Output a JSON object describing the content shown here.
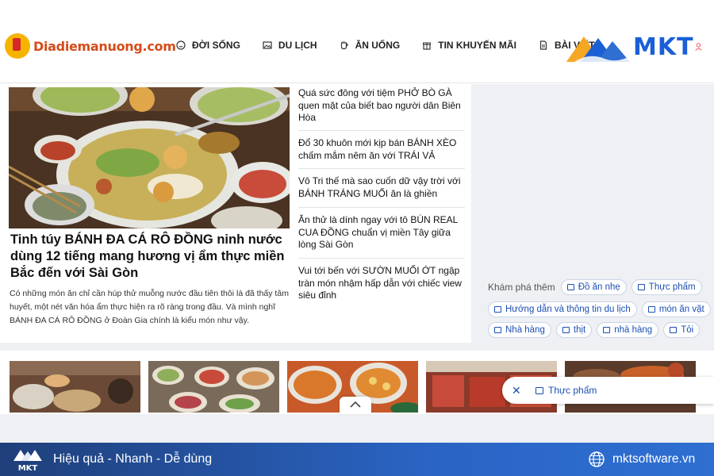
{
  "site": {
    "logo_text": "Diadiemanuong",
    "logo_suffix": ".com"
  },
  "nav": [
    {
      "label": "ĐỜI SỐNG",
      "icon": "smile-icon"
    },
    {
      "label": "DU LỊCH",
      "icon": "image-icon"
    },
    {
      "label": "ĂN UỐNG",
      "icon": "cup-icon"
    },
    {
      "label": "TIN KHUYẾN MÃI",
      "icon": "gift-icon"
    },
    {
      "label": "BÀI VIẾT",
      "icon": "document-icon"
    }
  ],
  "brand": {
    "name": "MKT",
    "colors": {
      "orange": "#f5a623",
      "blue": "#1a5fd6"
    }
  },
  "featured": {
    "title": "Tinh túy BÁNH ĐA CÁ RÔ ĐỒNG ninh nước dùng 12 tiếng mang hương vị ẩm thực miền Bắc đến với Sài Gòn",
    "excerpt": "Có những món ăn chỉ cần húp thử muỗng nước đầu tiên thôi là đã thấy tâm huyết, một nét văn hóa ẩm thực hiện ra rõ ràng trong đầu. Và mình nghĩ BÁNH ĐA CÁ RÔ ĐỒNG ở Đoàn Gia chính là kiểu món như vậy."
  },
  "articles": [
    "Quá sức đông với tiệm PHỞ BÒ GÀ quen mặt của biết bao người dân Biên Hòa",
    "Đổ 30 khuôn mới kịp bán BÁNH XÈO chấm mắm nêm ăn với TRÁI VẢ",
    "Vô Tri thế mà sao cuốn dữ vậy trời với BÁNH TRÁNG MUỐI ăn là ghiền",
    "Ăn thử là dính ngay với tô BÚN REAL CUA ĐỒNG chuẩn vị miền Tây giữa lòng Sài Gòn",
    "Vui tới bến với SƯỜN MUỐI ỚT ngập tràn món nhậm hấp dẫn với chiếc view siêu đỉnh"
  ],
  "explore": {
    "label": "Khám phá thêm",
    "tags": [
      "Đồ ăn nhẹ",
      "Thực phẩm",
      "Hướng dẫn và thông tin du lịch",
      "món ăn vặt",
      "Nhà hàng",
      "thịt",
      "nhà hàng",
      "Tỏi"
    ]
  },
  "popup_tag": "Thực phẩm",
  "footer": {
    "slogan": "Hiệu quả - Nhanh - Dễ dùng",
    "website": "mktsoftware.vn",
    "logo_text": "MKT"
  }
}
